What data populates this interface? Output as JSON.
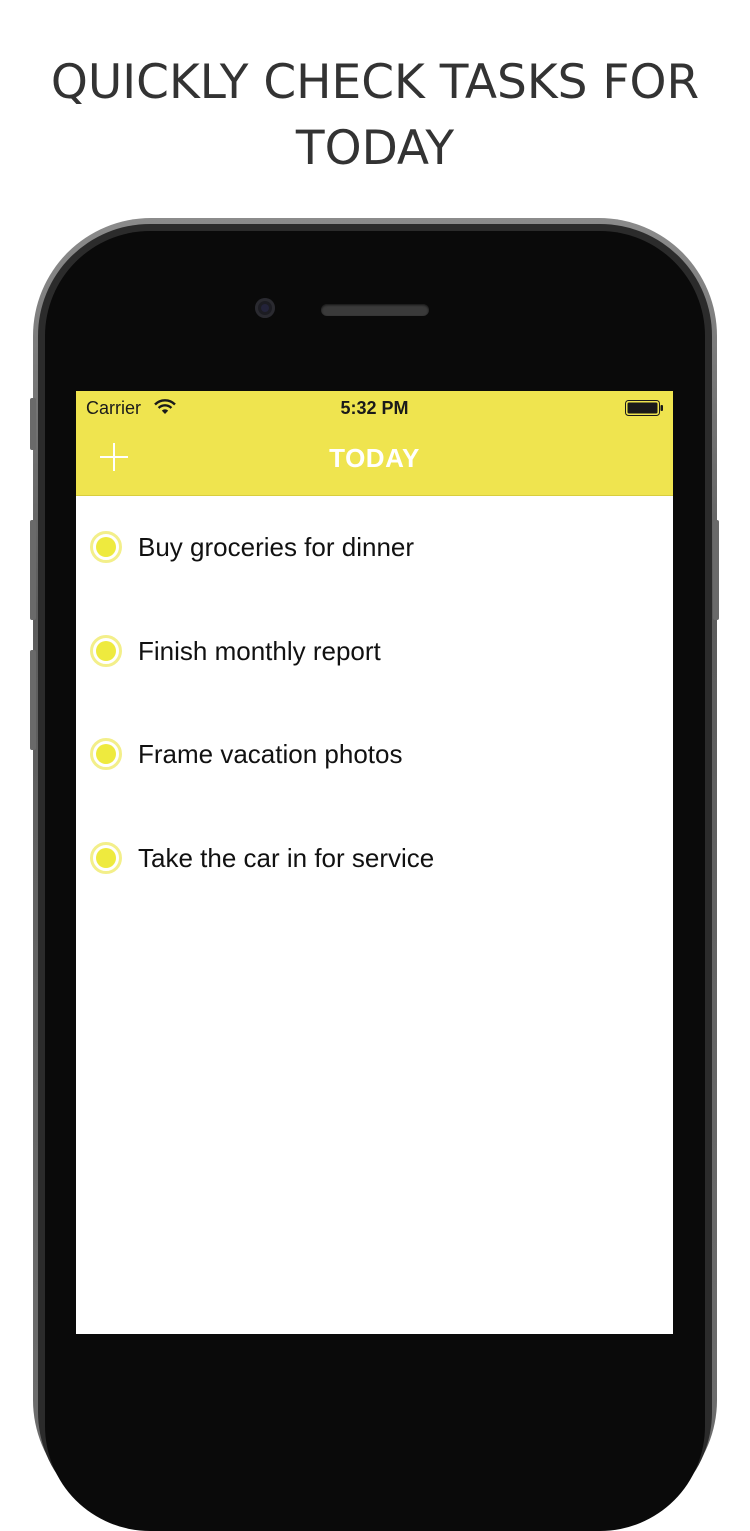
{
  "headline": {
    "line1": "QUICKLY CHECK TASKS FOR",
    "line2": "TODAY"
  },
  "status_bar": {
    "carrier": "Carrier",
    "time": "5:32 PM",
    "wifi_icon": "wifi-icon",
    "battery_icon": "battery-icon"
  },
  "nav": {
    "title": "TODAY",
    "add_icon": "plus-icon"
  },
  "tasks": [
    {
      "label": "Buy groceries for dinner",
      "icon": "circle-check-icon"
    },
    {
      "label": "Finish monthly report",
      "icon": "circle-check-icon"
    },
    {
      "label": "Frame vacation photos",
      "icon": "circle-check-icon"
    },
    {
      "label": "Take the car in for service",
      "icon": "circle-check-icon"
    }
  ],
  "colors": {
    "accent": "#efe44f",
    "check_fill": "#eeea3e",
    "check_ring": "#f3ef8a",
    "title_text": "#ffffff",
    "headline_text": "#333333"
  }
}
